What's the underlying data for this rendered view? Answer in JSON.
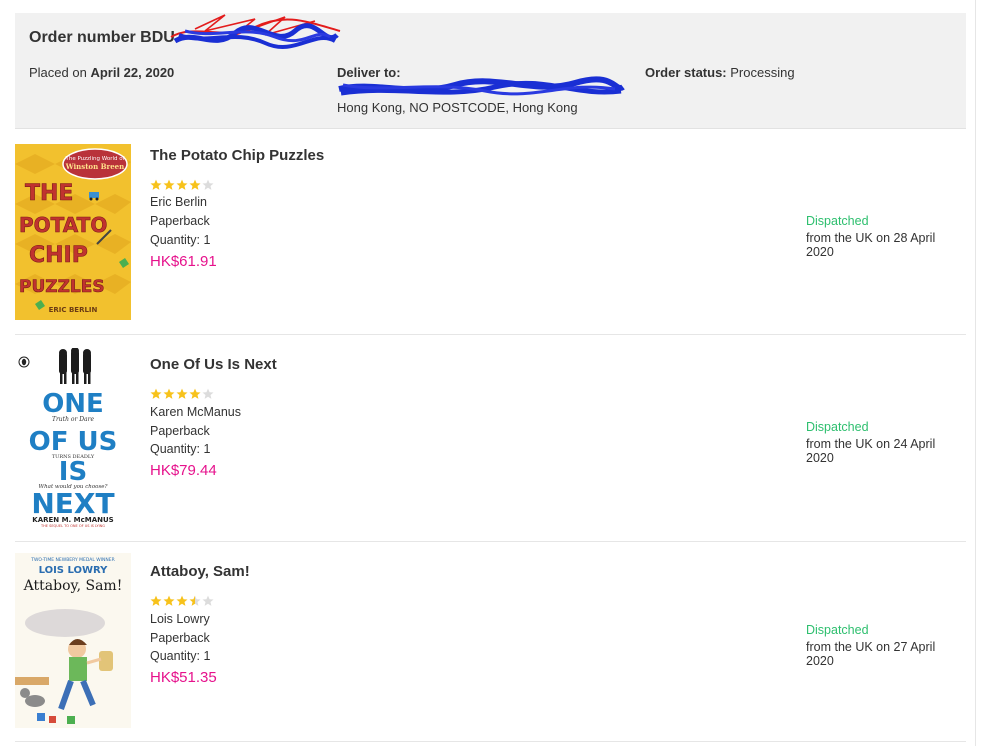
{
  "order": {
    "number_label": "Order number BDU",
    "placed_prefix": "Placed on",
    "placed_date": "April 22, 2020",
    "deliver_label": "Deliver to:",
    "deliver_address": "Hong Kong, NO POSTCODE, Hong Kong",
    "status_label": "Order status:",
    "status_value": "Processing"
  },
  "items": [
    {
      "title": "The Potato Chip Puzzles",
      "rating": 4,
      "author": "Eric Berlin",
      "format": "Paperback",
      "quantity": "Quantity: 1",
      "price": "HK$61.91",
      "status": "Dispatched",
      "dispatch_note": "from the UK on 28 April 2020",
      "cover": {
        "series": "The Puzzling World of",
        "series_name": "Winston Breen",
        "letters": [
          "THE",
          "POTATO",
          "CHIP",
          "PUZZLES"
        ],
        "author": "ERIC BERLIN",
        "bg": "#f2c12e"
      }
    },
    {
      "title": "One Of Us Is Next",
      "rating": 4,
      "author": "Karen McManus",
      "format": "Paperback",
      "quantity": "Quantity: 1",
      "price": "HK$79.44",
      "status": "Dispatched",
      "dispatch_note": "from the UK on 24 April 2020",
      "cover": {
        "l1": "ONE",
        "l2": "OF US",
        "l3": "IS",
        "l4": "NEXT",
        "tag1": "Truth or Dare",
        "tag2": "TURNS DEADLY",
        "tag3": "What would you choose?",
        "author": "KAREN M. McMANUS",
        "sequel": "THE SEQUEL TO ONE OF US IS LYING",
        "blue": "#1f7fc4"
      }
    },
    {
      "title": "Attaboy, Sam!",
      "rating": 3.5,
      "author": "Lois Lowry",
      "format": "Paperback",
      "quantity": "Quantity: 1",
      "price": "HK$51.35",
      "status": "Dispatched",
      "dispatch_note": "from the UK on 27 April 2020",
      "cover": {
        "tagline": "TWO-TIME NEWBERY MEDAL WINNER",
        "author": "LOIS LOWRY",
        "title": "Attaboy, Sam!"
      }
    }
  ],
  "colors": {
    "price": "#e6128c",
    "dispatched": "#2dbf6e",
    "star_on": "#f7c21b",
    "star_off": "#dcdcdc"
  }
}
